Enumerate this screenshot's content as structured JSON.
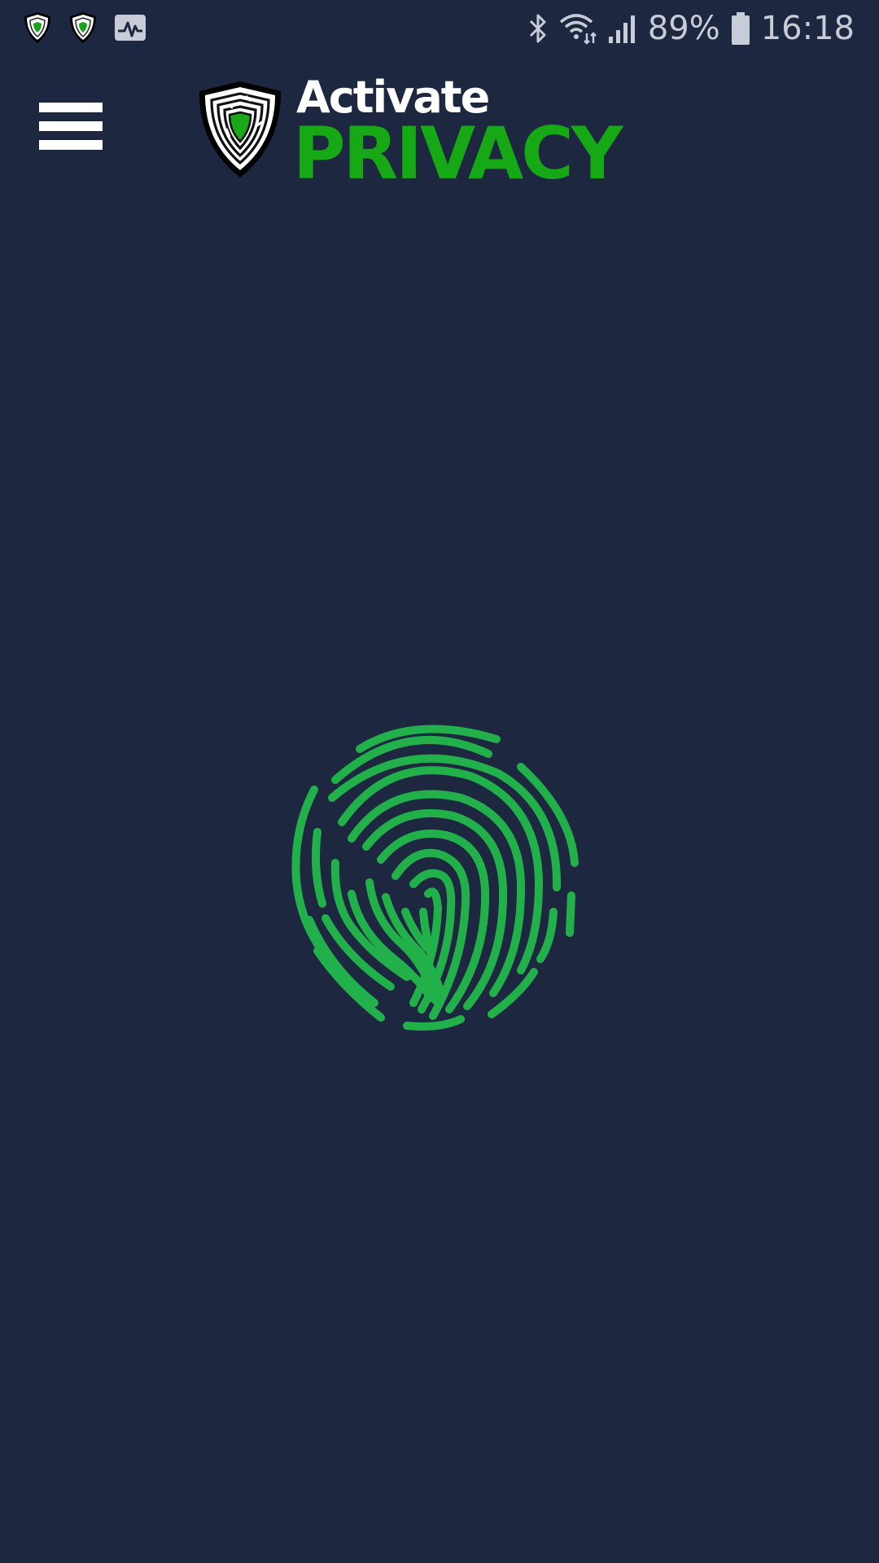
{
  "status_bar": {
    "left_icons": [
      "privacy-shield-icon",
      "privacy-shield-icon",
      "activity-monitor-icon"
    ],
    "right_icons": [
      "bluetooth-icon",
      "wifi-icon",
      "signal-icon",
      "battery-icon"
    ],
    "battery_percent": "89%",
    "time": "16:18"
  },
  "header": {
    "menu_icon": "hamburger-menu-icon",
    "logo": {
      "icon": "shield-fingerprint-logo",
      "word_top": "Activate",
      "word_bottom": "PRIVACY"
    }
  },
  "main": {
    "fingerprint_icon": "fingerprint-icon"
  },
  "colors": {
    "background": "#1d2740",
    "brand_green": "#16a815",
    "fingerprint_green": "#22b04b",
    "white": "#ffffff",
    "status_text": "#c8ccd6"
  }
}
